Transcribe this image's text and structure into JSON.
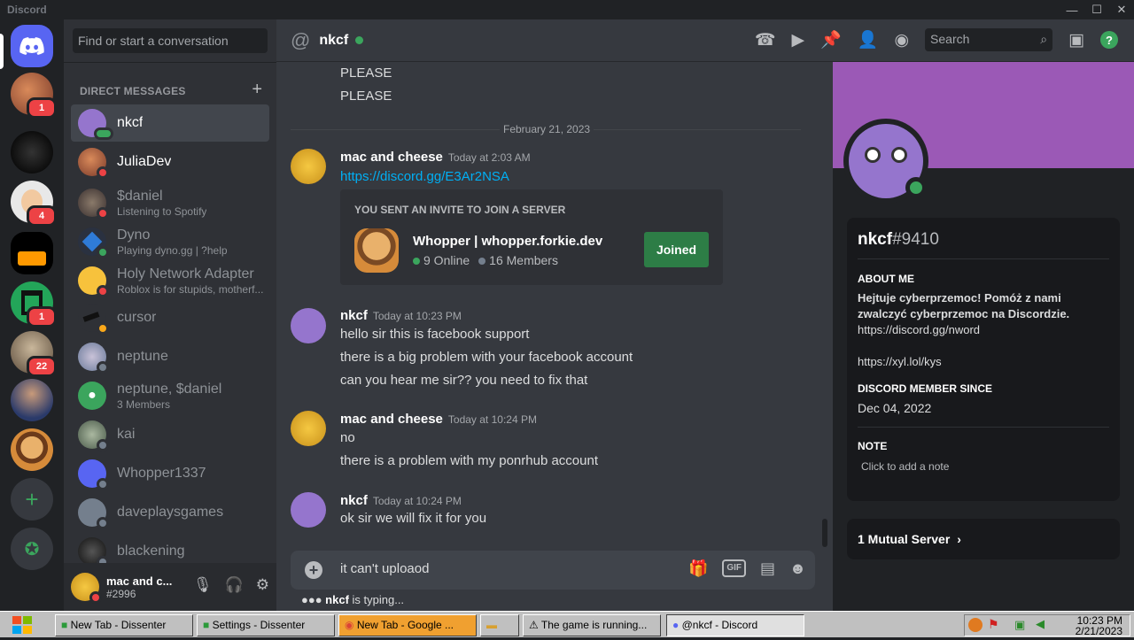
{
  "app": {
    "title": "Discord"
  },
  "servers": [
    {
      "badge": "1"
    },
    {
      "badge": ""
    },
    {
      "badge": "4"
    },
    {
      "badge": ""
    },
    {
      "badge": "1"
    },
    {
      "badge": "22"
    },
    {
      "badge": ""
    },
    {
      "badge": ""
    }
  ],
  "sidebar": {
    "search_placeholder": "Find or start a conversation",
    "header": "DIRECT MESSAGES",
    "items": [
      {
        "name": "nkcf",
        "sub": ""
      },
      {
        "name": "JuliaDev",
        "sub": ""
      },
      {
        "name": "$daniel",
        "sub": "Listening to Spotify"
      },
      {
        "name": "Dyno",
        "sub": "Playing dyno.gg | ?help"
      },
      {
        "name": "Holy Network Adapter",
        "sub": "Roblox is for stupids, motherf..."
      },
      {
        "name": "cursor",
        "sub": ""
      },
      {
        "name": "neptune",
        "sub": ""
      },
      {
        "name": "neptune, $daniel",
        "sub": "3 Members"
      },
      {
        "name": "kai",
        "sub": ""
      },
      {
        "name": "Whopper1337",
        "sub": ""
      },
      {
        "name": "daveplaysgames",
        "sub": ""
      },
      {
        "name": "blackening",
        "sub": ""
      }
    ]
  },
  "user": {
    "name": "mac and c...",
    "tag": "#2996"
  },
  "channel": {
    "name": "nkcf",
    "search_placeholder": "Search"
  },
  "messages": {
    "prev_lines": [
      "PLEASE",
      "PLEASE"
    ],
    "date_sep": "February 21, 2023",
    "groups": [
      {
        "author": "mac and cheese",
        "time": "Today at 2:03 AM",
        "lines": [
          "https://discord.gg/E3Ar2NSA"
        ]
      },
      {
        "author": "nkcf",
        "time": "Today at 10:23 PM",
        "lines": [
          "hello sir this is facebook support",
          "there is a big problem with your facebook account",
          "can you hear me sir?? you need to fix that"
        ]
      },
      {
        "author": "mac and cheese",
        "time": "Today at 10:24 PM",
        "lines": [
          "no",
          "there is a problem with my ponrhub account"
        ]
      },
      {
        "author": "nkcf",
        "time": "Today at 10:24 PM",
        "lines": [
          "ok sir we will fix it for you"
        ]
      }
    ]
  },
  "invite": {
    "title": "YOU SENT AN INVITE TO JOIN A SERVER",
    "server": "Whopper | whopper.forkie.dev",
    "online": "9 Online",
    "members": "16 Members",
    "button": "Joined"
  },
  "composer": {
    "value": "it can't uploaod",
    "typing_user": "nkcf",
    "typing_suffix": " is typing..."
  },
  "profile": {
    "name": "nkcf",
    "discriminator": "#9410",
    "about_h": "ABOUT ME",
    "about": "Hejtuje cyberprzemoc! Pomóż z nami zwalczyć cyberprzemoc na Discordzie.",
    "link1": "https://discord.gg/nword",
    "link2": "https://xyl.lol/kys",
    "since_h": "DISCORD MEMBER SINCE",
    "since": "Dec 04, 2022",
    "note_h": "NOTE",
    "note": "Click to add a note",
    "mutual": "1 Mutual Server"
  },
  "taskbar": {
    "items": [
      "New Tab - Dissenter",
      "Settings - Dissenter",
      "New Tab - Google ...",
      "",
      "The game is running...",
      "@nkcf - Discord"
    ],
    "time": "10:23 PM",
    "date": "2/21/2023"
  },
  "colors": {
    "accent": "#5865f2",
    "online": "#3ba55d",
    "dnd": "#ed4245",
    "idle": "#faa81a",
    "link": "#00aff4",
    "banner": "#9b59b6"
  }
}
